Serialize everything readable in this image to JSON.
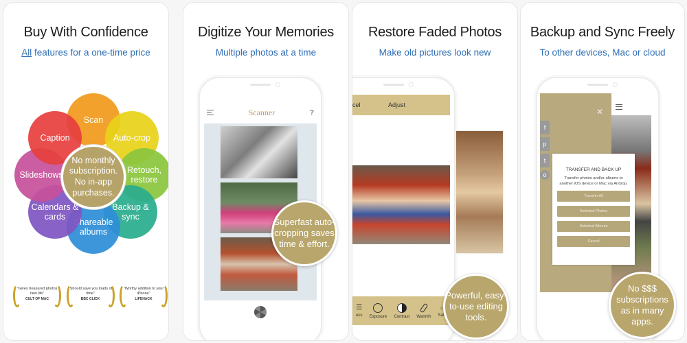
{
  "panels": [
    {
      "title": "Buy With Confidence",
      "subtitle_underlined": "All",
      "subtitle_rest": " features for a one-time price",
      "flower": {
        "center_text": "No monthly subscription. No in-app purchases.",
        "petals": [
          {
            "label": "Scan",
            "color": "#f29b1d"
          },
          {
            "label": "Auto-crop",
            "color": "#e9d21a"
          },
          {
            "label": "Retouch, restore",
            "color": "#8cc63f"
          },
          {
            "label": "Backup & sync",
            "color": "#2bae8e"
          },
          {
            "label": "Shareable albums",
            "color": "#2f8fd8"
          },
          {
            "label": "Calendars & cards",
            "color": "#7f57c2"
          },
          {
            "label": "Slideshows",
            "color": "#c8519b"
          },
          {
            "label": "Caption",
            "color": "#e8403f"
          }
        ]
      },
      "awards": [
        {
          "quote": "\"Gives treasured photos new life\"",
          "source": "CULT OF MAC"
        },
        {
          "quote": "\"Should save you loads of time\"",
          "source": "BBC CLICK"
        },
        {
          "quote": "\"Worthy addition to your iPhone\"",
          "source": "LIFEHACK"
        }
      ]
    },
    {
      "title": "Digitize Your Memories",
      "subtitle": "Multiple photos at a time",
      "app_title": "Scanner",
      "help": "?",
      "bubble": "Superfast auto-cropping saves time & effort."
    },
    {
      "title": "Restore Faded Photos",
      "subtitle": "Make old pictures look new",
      "toolbar": {
        "cancel": "cel",
        "adjust": "Adjust"
      },
      "tools": [
        "ess",
        "Exposure",
        "Contrast",
        "Warmth",
        "Satu"
      ],
      "bubble": "Powerful, easy-to-use editing tools."
    },
    {
      "title": "Backup and Sync Freely",
      "subtitle": "To other devices, Mac or cloud",
      "social": [
        "f",
        "p",
        "t",
        "o"
      ],
      "dialog": {
        "title": "TRANSFER AND BACK UP",
        "text": "Transfer photos and/or albums to another iOS device or Mac via Airdrop.",
        "buttons": [
          "Transfer All",
          "Selected Photos",
          "Selected Albums",
          "Cancel"
        ]
      },
      "bubble": "No $$$ subscriptions as in many apps."
    }
  ],
  "colors": {
    "gold": "#b8a66c",
    "link_blue": "#2f6fb6"
  }
}
